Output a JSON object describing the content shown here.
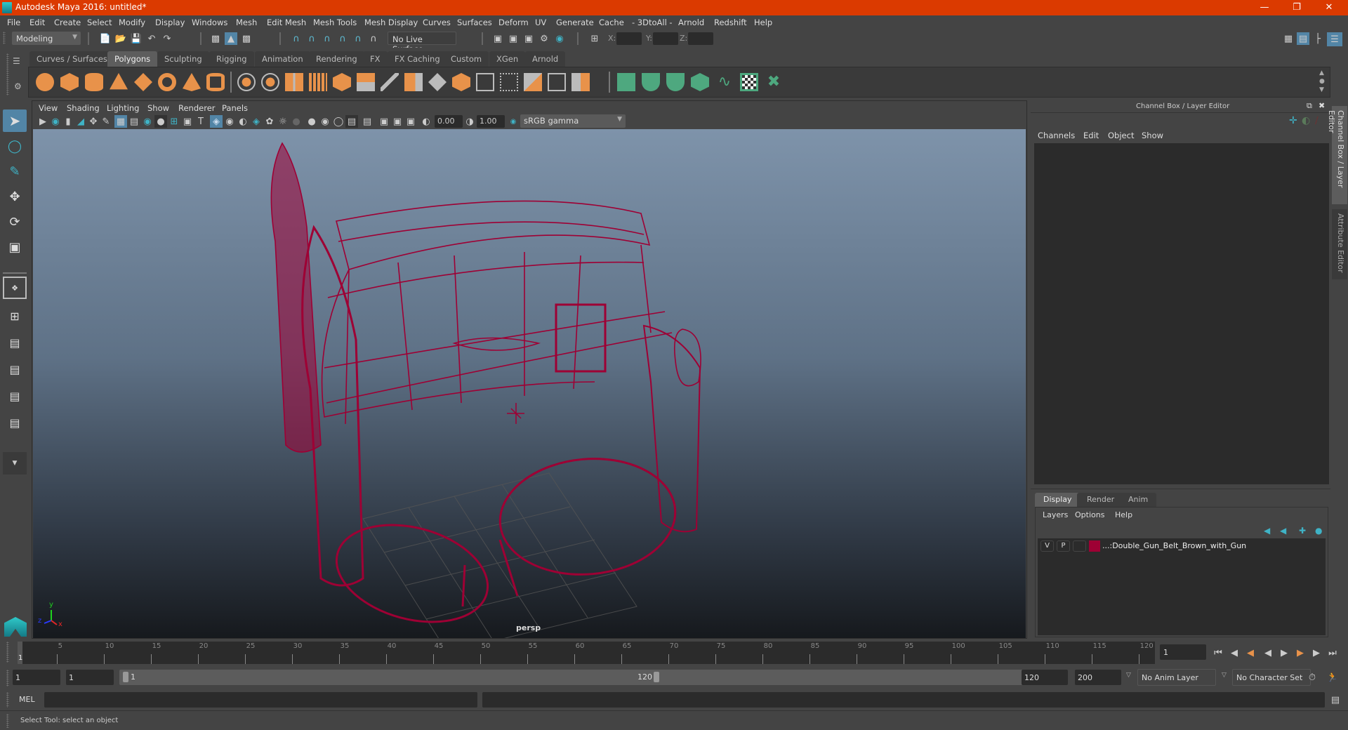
{
  "window": {
    "title": "Autodesk Maya 2016: untitled*",
    "minimize_icon": "minimize-icon",
    "restore_icon": "restore-icon",
    "close_icon": "close-icon"
  },
  "menubar": {
    "items": [
      "File",
      "Edit",
      "Create",
      "Select",
      "Modify",
      "Display",
      "Windows",
      "Mesh",
      "Edit Mesh",
      "Mesh Tools",
      "Mesh Display",
      "Curves",
      "Surfaces",
      "Deform",
      "UV",
      "Generate",
      "Cache",
      "- 3DtoAll -",
      "Arnold",
      "Redshift",
      "Help"
    ]
  },
  "statusline": {
    "mode": "Modeling",
    "live_surface": "No Live Surface",
    "x_label": "X:",
    "y_label": "Y:",
    "z_label": "Z:",
    "x_value": "",
    "y_value": "",
    "z_value": ""
  },
  "shelf": {
    "tabs": [
      "Curves / Surfaces",
      "Polygons",
      "Sculpting",
      "Rigging",
      "Animation",
      "Rendering",
      "FX",
      "FX Caching",
      "Custom",
      "XGen",
      "Arnold"
    ],
    "active_tab": "Polygons",
    "poly_icons": [
      "poly-sphere-icon",
      "poly-cube-icon",
      "poly-cylinder-icon",
      "poly-cone-icon",
      "poly-plane-icon",
      "poly-torus-icon",
      "poly-pyramid-icon",
      "poly-pipe-icon"
    ],
    "mesh_icons": [
      "combine-icon",
      "separate-icon",
      "mirror-icon",
      "smooth-icon",
      "extrude-icon",
      "bridge-icon",
      "bevel-icon",
      "multi-cut-icon",
      "target-weld-icon",
      "quad-draw-icon",
      "append-polygon-icon",
      "fill-hole-icon",
      "make-hole-icon",
      "reduce-icon",
      "boolean-icon"
    ],
    "uv_icons": [
      "planar-uv-icon",
      "cylindrical-uv-icon",
      "spherical-uv-icon",
      "automatic-uv-icon",
      "unfold-uv-icon",
      "uv-editor-icon",
      "sew-uv-icon"
    ]
  },
  "viewport": {
    "menus": [
      "View",
      "Shading",
      "Lighting",
      "Show",
      "Renderer",
      "Panels"
    ],
    "exposure": "0.00",
    "gamma": "1.00",
    "color_space": "sRGB gamma",
    "camera_label": "persp",
    "axis": {
      "x": "x",
      "y": "y",
      "z": "z"
    },
    "wire_color": "#9e0034"
  },
  "channelbox": {
    "title": "Channel Box / Layer Editor",
    "menus": [
      "Channels",
      "Edit",
      "Object",
      "Show"
    ]
  },
  "layereditor": {
    "tabs": [
      "Display",
      "Render",
      "Anim"
    ],
    "active_tab": "Display",
    "menus": [
      "Layers",
      "Options",
      "Help"
    ],
    "layers": [
      {
        "visible": "V",
        "playback": "P",
        "color": "#9e0034",
        "name": "...:Double_Gun_Belt_Brown_with_Gun"
      }
    ]
  },
  "sidetabs": [
    "Channel Box / Layer Editor",
    "Attribute Editor"
  ],
  "timeline": {
    "ticks": [
      "5",
      "10",
      "15",
      "20",
      "25",
      "30",
      "35",
      "40",
      "45",
      "50",
      "55",
      "60",
      "65",
      "70",
      "75",
      "80",
      "85",
      "90",
      "95",
      "100",
      "105",
      "110",
      "115",
      "120"
    ],
    "current_frame_marker": "1",
    "current_frame": "1"
  },
  "range": {
    "start_time": "1",
    "playback_start": "1",
    "slider_start": "1",
    "slider_end": "120",
    "playback_end": "120",
    "end_time": "200",
    "anim_layer": "No Anim Layer",
    "character_set": "No Character Set"
  },
  "command": {
    "language": "MEL",
    "input": "",
    "result": ""
  },
  "help_line": "Select Tool: select an object",
  "accent": "#5285a6"
}
